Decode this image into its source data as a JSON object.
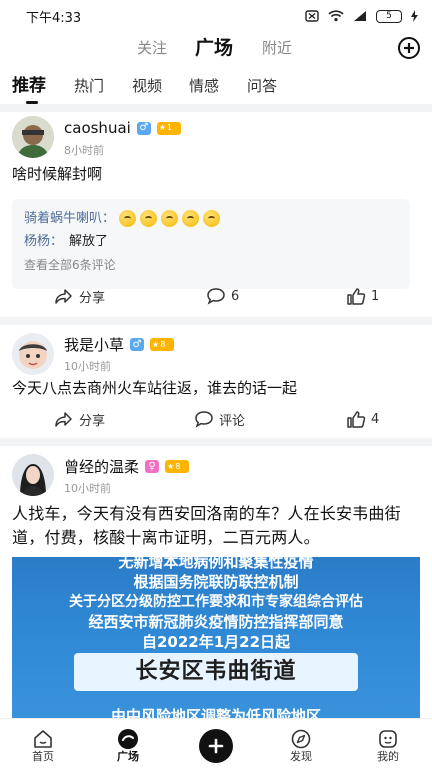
{
  "status_bar": {
    "time": "下午4:33",
    "battery": "5"
  },
  "top_nav": {
    "tabs": [
      {
        "label": "关注"
      },
      {
        "label": "广场"
      },
      {
        "label": "附近"
      }
    ]
  },
  "sub_tabs": [
    {
      "label": "推荐"
    },
    {
      "label": "热门"
    },
    {
      "label": "视频"
    },
    {
      "label": "情感"
    },
    {
      "label": "问答"
    }
  ],
  "posts": [
    {
      "username": "caoshuai",
      "gender": "♂",
      "level": "1",
      "time": "8小时前",
      "content": "啥时候解封啊",
      "comments": [
        {
          "author": "骑着蜗牛喇叭：",
          "emoji_count": 5
        },
        {
          "author": "杨杨：",
          "text": "解放了"
        }
      ],
      "see_all": "查看全部6条评论",
      "share_label": "分享",
      "comment_label": "6",
      "like_label": "1"
    },
    {
      "username": "我是小草",
      "gender": "♂",
      "level": "8",
      "time": "10小时前",
      "content": "今天八点去商州火车站往返，谁去的话一起",
      "share_label": "分享",
      "comment_label": "评论",
      "like_label": "4"
    },
    {
      "username": "曾经的温柔",
      "gender": "♀",
      "level": "8",
      "time": "10小时前",
      "content": "人找车，今天有没有西安回洛南的车？人在长安韦曲街道，付费，核酸十离市证明，二百元两人。",
      "image_text": [
        "无新增本地病例和聚集性疫情",
        "根据国务院联防联控机制",
        "关于分区分级防控工作要求和市专家组综合评估",
        "经西安市新冠肺炎疫情防控指挥部同意",
        "自2022年1月22日起",
        "长安区韦曲街道",
        "由中风险地区调整为低风险地区"
      ]
    }
  ],
  "bottom_nav": {
    "items": [
      {
        "label": "首页"
      },
      {
        "label": "广场"
      },
      {
        "label": "发现"
      },
      {
        "label": "我的"
      }
    ]
  },
  "colors": {
    "accent": "#111111",
    "comment_author": "#4d6d99",
    "level_badge": "#ffb400",
    "male_badge": "#5aa8f0",
    "female_badge": "#f06fc3"
  }
}
